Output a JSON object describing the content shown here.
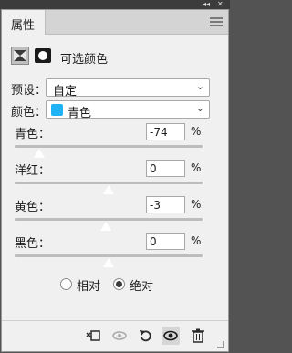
{
  "window": {
    "collapse_glyph": "◂◂",
    "close_glyph": "✕"
  },
  "panel": {
    "tab_label": "属性",
    "menu_icon": "hamburger-icon"
  },
  "header": {
    "mask_icon": "mask-icon",
    "layer_icon": "layer-mask-icon",
    "title": "可选颜色"
  },
  "preset": {
    "label": "预设：",
    "value": "自定"
  },
  "colors": {
    "label": "颜色：",
    "value": "青色",
    "swatch_color": "#1fb3f5"
  },
  "sliders": [
    {
      "label": "青色：",
      "value": "-74",
      "unit": "%",
      "level": -74,
      "range": [
        -100,
        100
      ]
    },
    {
      "label": "洋红：",
      "value": "0",
      "unit": "%",
      "level": 0,
      "range": [
        -100,
        100
      ]
    },
    {
      "label": "黄色：",
      "value": "-3",
      "unit": "%",
      "level": -3,
      "range": [
        -100,
        100
      ]
    },
    {
      "label": "黑色：",
      "value": "0",
      "unit": "%",
      "level": 0,
      "range": [
        -100,
        100
      ]
    }
  ],
  "method": {
    "options": [
      {
        "label": "相对",
        "selected": false
      },
      {
        "label": "绝对",
        "selected": true
      }
    ]
  },
  "footer": {
    "icons": [
      "clip-to-layer-icon",
      "view-previous-icon",
      "reset-icon",
      "visibility-eye-icon",
      "trash-icon"
    ]
  }
}
